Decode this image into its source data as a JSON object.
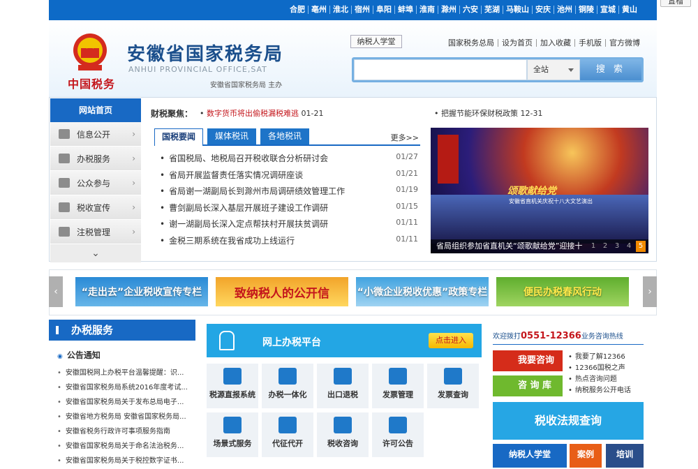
{
  "float_btn": "置榴",
  "cities": [
    "合肥",
    "亳州",
    "淮北",
    "宿州",
    "阜阳",
    "蚌埠",
    "淮南",
    "滁州",
    "六安",
    "芜湖",
    "马鞍山",
    "安庆",
    "池州",
    "铜陵",
    "宣城",
    "黄山"
  ],
  "header": {
    "title": "安徽省国家税务局",
    "subtitle": "ANHUI PROVINCIAL OFFICE,SAT",
    "host": "安徽省国家税务局 主办",
    "seal": "中国税务",
    "school": "纳税人学堂",
    "links": [
      "国家税务总局",
      "设为首页",
      "加入收藏",
      "手机版",
      "官方微博"
    ],
    "search_scope": "全站",
    "search_btn": "搜 索"
  },
  "nav": {
    "home": "网站首页",
    "items": [
      {
        "label": "信息公开",
        "icon": "building-icon"
      },
      {
        "label": "办税服务",
        "icon": "briefcase-icon"
      },
      {
        "label": "公众参与",
        "icon": "people-icon"
      },
      {
        "label": "税收宣传",
        "icon": "book-icon"
      },
      {
        "label": "注税管理",
        "icon": "edit-icon"
      }
    ],
    "more": "⌄"
  },
  "focus": {
    "label": "财税聚焦：",
    "item1": "数字货币将出偷税漏税难逃",
    "date1": "01-21",
    "item2": "把握节能环保财税政策",
    "date2": "12-31"
  },
  "tabs": {
    "items": [
      "国税要闻",
      "媒体税讯",
      "各地税讯"
    ],
    "more": "更多>>"
  },
  "news": [
    {
      "title": "省国税局、地税局召开税收联合分析研讨会",
      "date": "01/27"
    },
    {
      "title": "省局开展监督责任落实情况调研座谈",
      "date": "01/21"
    },
    {
      "title": "省局谢一湖副局长到滁州市局调研绩效管理工作",
      "date": "01/19"
    },
    {
      "title": "曹剑副局长深入基层开展班子建设工作调研",
      "date": "01/15"
    },
    {
      "title": "谢一湖副局长深入定点帮扶村开展扶贫调研",
      "date": "01/11"
    },
    {
      "title": "金税三期系统在我省成功上线运行",
      "date": "01/11"
    }
  ],
  "photo": {
    "caption": "省局组织参加省直机关“颂歌献给党”迎接十",
    "banner_text": "颂歌献给党",
    "banner_sub": "安徽省直机关庆祝十八大文艺演出",
    "pages": [
      "1",
      "2",
      "3",
      "4",
      "5"
    ],
    "active_page": 5
  },
  "banners": [
    "“走出去”企业税收宣传专栏",
    "致纳税人的公开信",
    "“小微企业税收优惠”政策专栏",
    "便民办税春风行动"
  ],
  "service": {
    "heading": "办税服务",
    "notice_title": "公告通知",
    "notices": [
      "安徽国税网上办税平台温馨提醒：识...",
      "安徽省国家税务局系统2016年度考试...",
      "安徽省国家税务局关于发布总局电子...",
      "安徽省地方税务局 安徽省国家税务局...",
      "安徽省税务行政许可事项服务指南",
      "安徽省国家税务局关于命名法治税务...",
      "安徽省国家税务局关于税控数字证书..."
    ]
  },
  "platform": {
    "title": "网上办税平台",
    "button": "点击进入"
  },
  "tiles": [
    "税源直报系统",
    "办税一体化",
    "出口退税",
    "发票管理",
    "发票查询",
    "场景式服务",
    "代征代开",
    "税收咨询",
    "许可公告"
  ],
  "right": {
    "hotline_prefix": "欢迎拨打",
    "hotline_number": "0551-12366",
    "hotline_suffix": "业务咨询热线",
    "ask": "我要咨询",
    "library": "咨 询 库",
    "quick": [
      "我要了解12366",
      "12366国税之声",
      "热点咨询问题",
      "纳税服务公开电话"
    ],
    "query": "税收法规查询",
    "bottom": [
      "纳税人学堂",
      "案例",
      "培训"
    ]
  }
}
